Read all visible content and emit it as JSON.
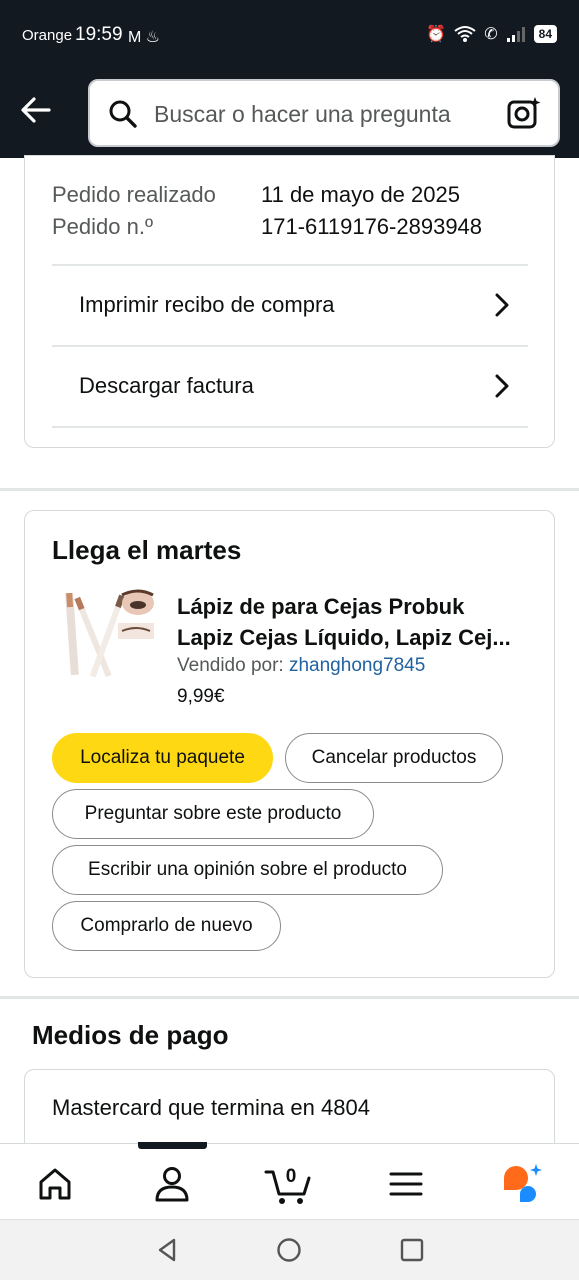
{
  "status_bar": {
    "carrier": "Orange",
    "time": "19:59",
    "notif_icons": "M ♨",
    "battery": "84"
  },
  "header": {
    "search_placeholder": "Buscar o hacer una pregunta"
  },
  "order": {
    "placed_label": "Pedido realizado",
    "placed_value": "11 de mayo de 2025",
    "number_label": "Pedido n.º",
    "number_value": "171-6119176-2893948",
    "print_receipt": "Imprimir recibo de compra",
    "download_invoice": "Descargar factura"
  },
  "shipment": {
    "arrival": "Llega el martes",
    "product_title_line1": "Lápiz de para Cejas Probuk",
    "product_title_line2": "Lapiz Cejas Líquido, Lapiz Cej...",
    "seller_label": "Vendido por:",
    "seller_name": "zhanghong7845",
    "price": "9,99€",
    "buttons": {
      "track": "Localiza tu paquete",
      "cancel": "Cancelar productos",
      "ask": "Preguntar sobre este producto",
      "review": "Escribir una opinión sobre el producto",
      "buy_again": "Comprarlo de nuevo"
    }
  },
  "payment": {
    "title": "Medios de pago",
    "method": "Mastercard  que termina en 4804"
  },
  "bottom_nav": {
    "cart_count": "0",
    "items": [
      "home-icon",
      "account-icon",
      "cart-icon",
      "menu-icon",
      "rufus-icon"
    ]
  },
  "colors": {
    "header_bg": "#131921",
    "primary_button": "#ffd814",
    "link": "#2162a1",
    "rufus_orange": "#ff6b1a",
    "rufus_blue": "#1a8cff"
  }
}
